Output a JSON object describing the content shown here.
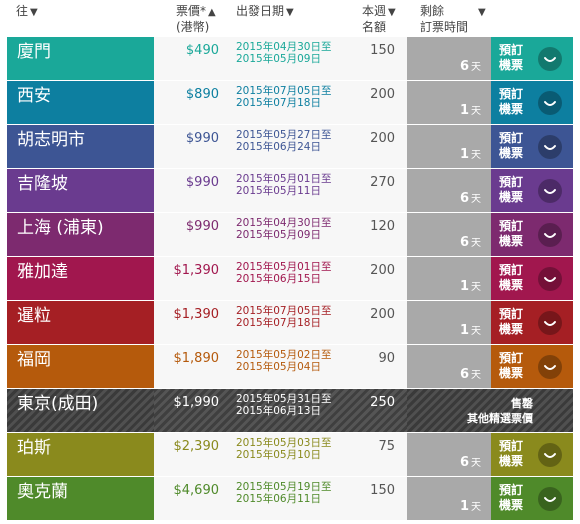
{
  "header": {
    "destination": "往",
    "price_line1": "票價*",
    "price_line2": "(港幣)",
    "dates": "出發日期",
    "seats_line1": "本週",
    "seats_line2": "名額",
    "remain_line1": "剩餘",
    "remain_line2": "訂票時間",
    "sort_desc": "▼",
    "sort_asc": "▲"
  },
  "rows": [
    {
      "dest": "廈門",
      "price": "$490",
      "d1": "2015年04月30日至",
      "d2": "2015年05月09日",
      "seats": "150",
      "remain": "6",
      "unit": "天",
      "book": "預訂機票",
      "color": "#1aa899",
      "soldout": false
    },
    {
      "dest": "西安",
      "price": "$890",
      "d1": "2015年07月05日至",
      "d2": "2015年07月18日",
      "seats": "200",
      "remain": "1",
      "unit": "天",
      "book": "預訂機票",
      "color": "#0d7fa0",
      "soldout": false
    },
    {
      "dest": "胡志明市",
      "price": "$990",
      "d1": "2015年05月27日至",
      "d2": "2015年06月24日",
      "seats": "200",
      "remain": "1",
      "unit": "天",
      "book": "預訂機票",
      "color": "#3d5594",
      "soldout": false
    },
    {
      "dest": "吉隆坡",
      "price": "$990",
      "d1": "2015年05月01日至",
      "d2": "2015年05月11日",
      "seats": "270",
      "remain": "6",
      "unit": "天",
      "book": "預訂機票",
      "color": "#6a3b8f",
      "soldout": false
    },
    {
      "dest": "上海 (浦東)",
      "price": "$990",
      "d1": "2015年04月30日至",
      "d2": "2015年05月09日",
      "seats": "120",
      "remain": "6",
      "unit": "天",
      "book": "預訂機票",
      "color": "#7d2a6f",
      "soldout": false
    },
    {
      "dest": "雅加達",
      "price": "$1,390",
      "d1": "2015年05月01日至",
      "d2": "2015年06月15日",
      "seats": "200",
      "remain": "1",
      "unit": "天",
      "book": "預訂機票",
      "color": "#a1174e",
      "soldout": false
    },
    {
      "dest": "暹粒",
      "price": "$1,390",
      "d1": "2015年07月05日至",
      "d2": "2015年07月18日",
      "seats": "200",
      "remain": "1",
      "unit": "天",
      "book": "預訂機票",
      "color": "#a51f24",
      "soldout": false
    },
    {
      "dest": "福岡",
      "price": "$1,890",
      "d1": "2015年05月02日至",
      "d2": "2015年05月04日",
      "seats": "90",
      "remain": "6",
      "unit": "天",
      "book": "預訂機票",
      "color": "#b55a0c",
      "soldout": false
    },
    {
      "dest": "東京(成田)",
      "price": "$1,990",
      "d1": "2015年05月31日至",
      "d2": "2015年06月13日",
      "seats": "250",
      "remain": "",
      "unit": "",
      "book": "售罄",
      "book2": "其他精選票價",
      "color": "#3a3a3a",
      "soldout": true
    },
    {
      "dest": "珀斯",
      "price": "$2,390",
      "d1": "2015年05月03日至",
      "d2": "2015年05月10日",
      "seats": "75",
      "remain": "6",
      "unit": "天",
      "book": "預訂機票",
      "color": "#8a8a1d",
      "soldout": false
    },
    {
      "dest": "奧克蘭",
      "price": "$4,690",
      "d1": "2015年05月19日至",
      "d2": "2015年06月11日",
      "seats": "150",
      "remain": "1",
      "unit": "天",
      "book": "預訂機票",
      "color": "#4f8a2a",
      "soldout": false
    }
  ]
}
